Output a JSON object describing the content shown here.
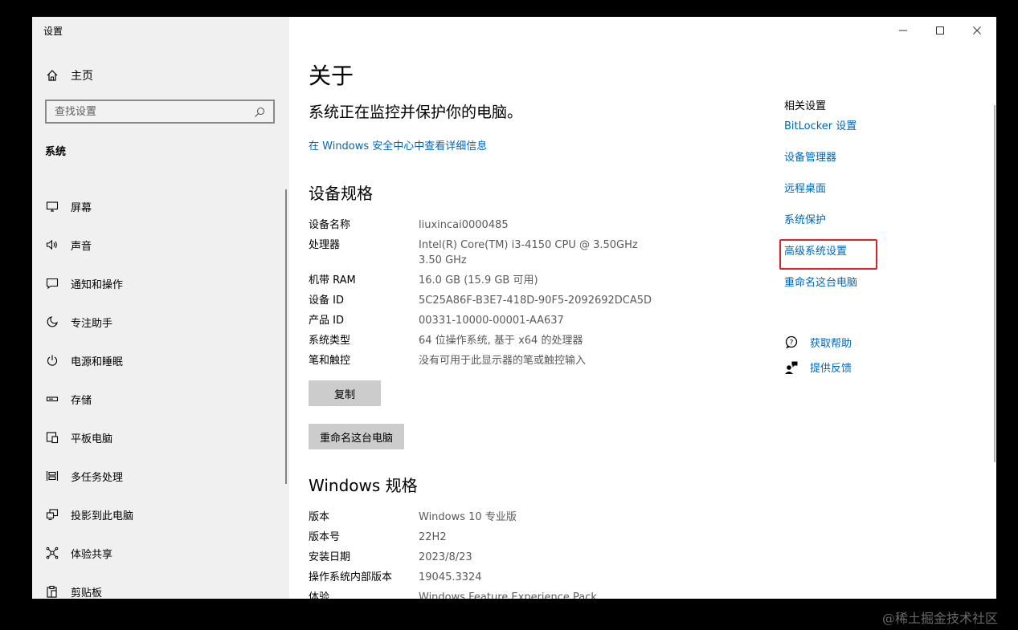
{
  "window": {
    "title": "设置"
  },
  "window_controls": [
    {
      "name": "minimize",
      "glyph": "—"
    },
    {
      "name": "maximize",
      "glyph": "☐"
    },
    {
      "name": "close",
      "glyph": "✕"
    }
  ],
  "sidebar": {
    "home_label": "主页",
    "search_placeholder": "查找设置",
    "section_title": "系统",
    "items": [
      {
        "label": "屏幕",
        "icon": "monitor-icon"
      },
      {
        "label": "声音",
        "icon": "speaker-icon"
      },
      {
        "label": "通知和操作",
        "icon": "notification-icon"
      },
      {
        "label": "专注助手",
        "icon": "moon-icon"
      },
      {
        "label": "电源和睡眠",
        "icon": "power-icon"
      },
      {
        "label": "存储",
        "icon": "storage-icon"
      },
      {
        "label": "平板电脑",
        "icon": "tablet-icon"
      },
      {
        "label": "多任务处理",
        "icon": "multitask-icon"
      },
      {
        "label": "投影到此电脑",
        "icon": "project-icon"
      },
      {
        "label": "体验共享",
        "icon": "share-icon"
      },
      {
        "label": "剪贴板",
        "icon": "clipboard-icon"
      }
    ]
  },
  "main": {
    "title": "关于",
    "status": "系统正在监控并保护你的电脑。",
    "security_link": "在 Windows 安全中心中查看详细信息",
    "device_spec_title": "设备规格",
    "device_specs": [
      {
        "key": "设备名称",
        "value": "liuxincai0000485"
      },
      {
        "key": "处理器",
        "value": "Intel(R) Core(TM) i3-4150 CPU @ 3.50GHz   3.50 GHz"
      },
      {
        "key": "机带 RAM",
        "value": "16.0 GB (15.9 GB 可用)"
      },
      {
        "key": "设备 ID",
        "value": "5C25A86F-B3E7-418D-90F5-2092692DCA5D"
      },
      {
        "key": "产品 ID",
        "value": "00331-10000-00001-AA637"
      },
      {
        "key": "系统类型",
        "value": "64 位操作系统, 基于 x64 的处理器"
      },
      {
        "key": "笔和触控",
        "value": "没有可用于此显示器的笔或触控输入"
      }
    ],
    "copy_button": "复制",
    "rename_button": "重命名这台电脑",
    "windows_spec_title": "Windows 规格",
    "windows_specs": [
      {
        "key": "版本",
        "value": "Windows 10 专业版"
      },
      {
        "key": "版本号",
        "value": "22H2"
      },
      {
        "key": "安装日期",
        "value": "2023/8/23"
      },
      {
        "key": "操作系统内部版本",
        "value": "19045.3324"
      },
      {
        "key": "体验",
        "value": "Windows Feature Experience Pack"
      }
    ]
  },
  "related": {
    "title": "相关设置",
    "links": [
      "BitLocker 设置",
      "设备管理器",
      "远程桌面",
      "系统保护",
      "高级系统设置",
      "重命名这台电脑"
    ],
    "highlighted": "高级系统设置",
    "highlight_color": "#e0202a"
  },
  "help": {
    "get_help": "获取帮助",
    "feedback": "提供反馈"
  },
  "colors": {
    "link": "#0067b8",
    "sidebar_bg": "#f0f0f0",
    "button_bg": "#cccccc"
  },
  "watermark": "@稀土掘金技术社区"
}
